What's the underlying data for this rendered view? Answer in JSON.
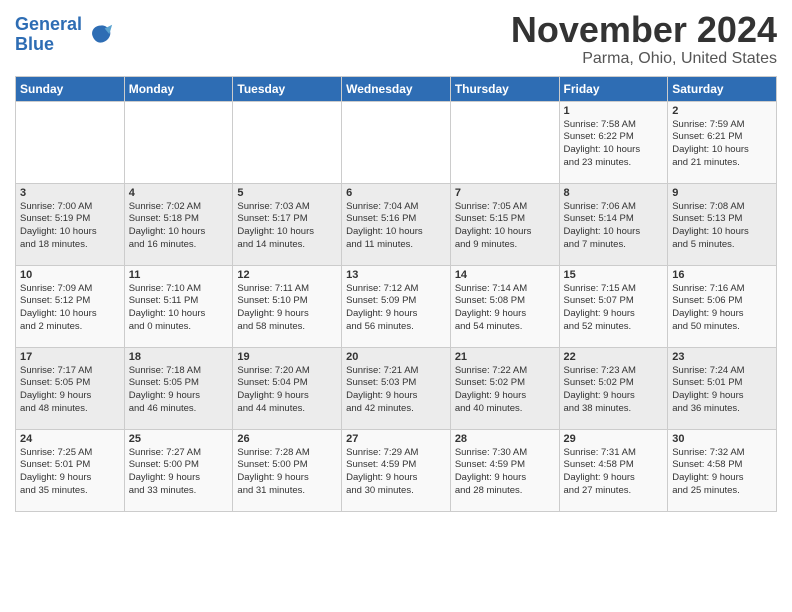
{
  "header": {
    "logo_line1": "General",
    "logo_line2": "Blue",
    "month": "November 2024",
    "location": "Parma, Ohio, United States"
  },
  "weekdays": [
    "Sunday",
    "Monday",
    "Tuesday",
    "Wednesday",
    "Thursday",
    "Friday",
    "Saturday"
  ],
  "weeks": [
    [
      {
        "day": "",
        "content": ""
      },
      {
        "day": "",
        "content": ""
      },
      {
        "day": "",
        "content": ""
      },
      {
        "day": "",
        "content": ""
      },
      {
        "day": "",
        "content": ""
      },
      {
        "day": "1",
        "content": "Sunrise: 7:58 AM\nSunset: 6:22 PM\nDaylight: 10 hours\nand 23 minutes."
      },
      {
        "day": "2",
        "content": "Sunrise: 7:59 AM\nSunset: 6:21 PM\nDaylight: 10 hours\nand 21 minutes."
      }
    ],
    [
      {
        "day": "3",
        "content": "Sunrise: 7:00 AM\nSunset: 5:19 PM\nDaylight: 10 hours\nand 18 minutes."
      },
      {
        "day": "4",
        "content": "Sunrise: 7:02 AM\nSunset: 5:18 PM\nDaylight: 10 hours\nand 16 minutes."
      },
      {
        "day": "5",
        "content": "Sunrise: 7:03 AM\nSunset: 5:17 PM\nDaylight: 10 hours\nand 14 minutes."
      },
      {
        "day": "6",
        "content": "Sunrise: 7:04 AM\nSunset: 5:16 PM\nDaylight: 10 hours\nand 11 minutes."
      },
      {
        "day": "7",
        "content": "Sunrise: 7:05 AM\nSunset: 5:15 PM\nDaylight: 10 hours\nand 9 minutes."
      },
      {
        "day": "8",
        "content": "Sunrise: 7:06 AM\nSunset: 5:14 PM\nDaylight: 10 hours\nand 7 minutes."
      },
      {
        "day": "9",
        "content": "Sunrise: 7:08 AM\nSunset: 5:13 PM\nDaylight: 10 hours\nand 5 minutes."
      }
    ],
    [
      {
        "day": "10",
        "content": "Sunrise: 7:09 AM\nSunset: 5:12 PM\nDaylight: 10 hours\nand 2 minutes."
      },
      {
        "day": "11",
        "content": "Sunrise: 7:10 AM\nSunset: 5:11 PM\nDaylight: 10 hours\nand 0 minutes."
      },
      {
        "day": "12",
        "content": "Sunrise: 7:11 AM\nSunset: 5:10 PM\nDaylight: 9 hours\nand 58 minutes."
      },
      {
        "day": "13",
        "content": "Sunrise: 7:12 AM\nSunset: 5:09 PM\nDaylight: 9 hours\nand 56 minutes."
      },
      {
        "day": "14",
        "content": "Sunrise: 7:14 AM\nSunset: 5:08 PM\nDaylight: 9 hours\nand 54 minutes."
      },
      {
        "day": "15",
        "content": "Sunrise: 7:15 AM\nSunset: 5:07 PM\nDaylight: 9 hours\nand 52 minutes."
      },
      {
        "day": "16",
        "content": "Sunrise: 7:16 AM\nSunset: 5:06 PM\nDaylight: 9 hours\nand 50 minutes."
      }
    ],
    [
      {
        "day": "17",
        "content": "Sunrise: 7:17 AM\nSunset: 5:05 PM\nDaylight: 9 hours\nand 48 minutes."
      },
      {
        "day": "18",
        "content": "Sunrise: 7:18 AM\nSunset: 5:05 PM\nDaylight: 9 hours\nand 46 minutes."
      },
      {
        "day": "19",
        "content": "Sunrise: 7:20 AM\nSunset: 5:04 PM\nDaylight: 9 hours\nand 44 minutes."
      },
      {
        "day": "20",
        "content": "Sunrise: 7:21 AM\nSunset: 5:03 PM\nDaylight: 9 hours\nand 42 minutes."
      },
      {
        "day": "21",
        "content": "Sunrise: 7:22 AM\nSunset: 5:02 PM\nDaylight: 9 hours\nand 40 minutes."
      },
      {
        "day": "22",
        "content": "Sunrise: 7:23 AM\nSunset: 5:02 PM\nDaylight: 9 hours\nand 38 minutes."
      },
      {
        "day": "23",
        "content": "Sunrise: 7:24 AM\nSunset: 5:01 PM\nDaylight: 9 hours\nand 36 minutes."
      }
    ],
    [
      {
        "day": "24",
        "content": "Sunrise: 7:25 AM\nSunset: 5:01 PM\nDaylight: 9 hours\nand 35 minutes."
      },
      {
        "day": "25",
        "content": "Sunrise: 7:27 AM\nSunset: 5:00 PM\nDaylight: 9 hours\nand 33 minutes."
      },
      {
        "day": "26",
        "content": "Sunrise: 7:28 AM\nSunset: 5:00 PM\nDaylight: 9 hours\nand 31 minutes."
      },
      {
        "day": "27",
        "content": "Sunrise: 7:29 AM\nSunset: 4:59 PM\nDaylight: 9 hours\nand 30 minutes."
      },
      {
        "day": "28",
        "content": "Sunrise: 7:30 AM\nSunset: 4:59 PM\nDaylight: 9 hours\nand 28 minutes."
      },
      {
        "day": "29",
        "content": "Sunrise: 7:31 AM\nSunset: 4:58 PM\nDaylight: 9 hours\nand 27 minutes."
      },
      {
        "day": "30",
        "content": "Sunrise: 7:32 AM\nSunset: 4:58 PM\nDaylight: 9 hours\nand 25 minutes."
      }
    ]
  ]
}
